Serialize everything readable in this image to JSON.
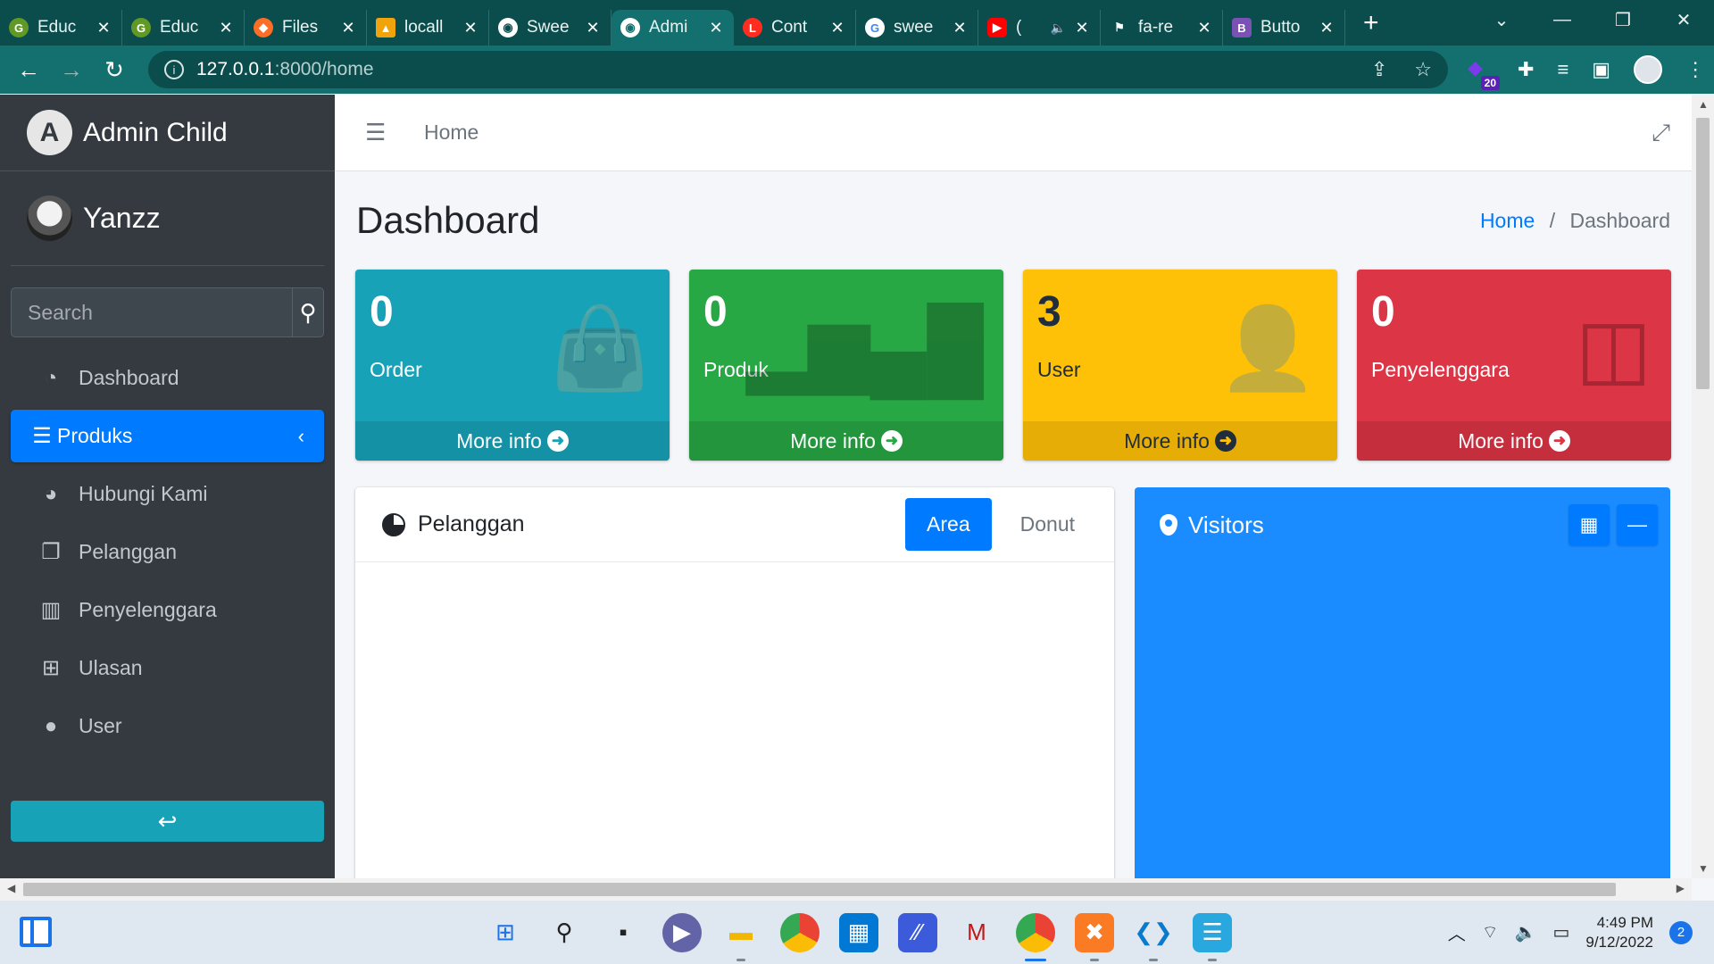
{
  "browser": {
    "tabs": [
      {
        "title": "Educ",
        "icon": "gitea-icon",
        "color": "#609926"
      },
      {
        "title": "Educ",
        "icon": "gitea-icon",
        "color": "#609926"
      },
      {
        "title": "Files",
        "icon": "gitlab-icon",
        "color": "#fc6d26"
      },
      {
        "title": "locall",
        "icon": "xampp-phpmyadmin-icon",
        "color": "#f0a30a"
      },
      {
        "title": "Swee",
        "icon": "globe-icon",
        "color": "#ffffff"
      },
      {
        "title": "Admi",
        "icon": "globe-icon",
        "color": "#ffffff",
        "active": true
      },
      {
        "title": "Cont",
        "icon": "laravel-icon",
        "color": "#ff2d20"
      },
      {
        "title": "swee",
        "icon": "google-icon",
        "color": "#4285f4"
      },
      {
        "title": "(",
        "icon": "youtube-icon",
        "color": "#ff0000"
      },
      {
        "title": "fa-re",
        "icon": "flag-icon",
        "color": "#ffffff"
      },
      {
        "title": "Butto",
        "icon": "bootstrap-icon",
        "color": "#7952b3"
      }
    ],
    "address": {
      "host": "127.0.0.1",
      "path": ":8000/home"
    },
    "extension_badge": "20"
  },
  "sidebar": {
    "brand": "Admin Child",
    "brand_logo_letter": "A",
    "user_name": "Yanzz",
    "search_placeholder": "Search",
    "items": [
      {
        "label": "Dashboard",
        "icon": "tachometer-icon"
      },
      {
        "label": "Produks",
        "icon": "list-icon",
        "active": true
      },
      {
        "label": "Hubungi Kami",
        "icon": "chart-pie-icon"
      },
      {
        "label": "Pelanggan",
        "icon": "copy-icon"
      },
      {
        "label": "Penyelenggara",
        "icon": "columns-icon"
      },
      {
        "label": "Ulasan",
        "icon": "plus-square-icon"
      },
      {
        "label": "User",
        "icon": "user-icon"
      }
    ],
    "back_icon": "reply-icon"
  },
  "topnav": {
    "home": "Home"
  },
  "header": {
    "title": "Dashboard",
    "breadcrumb": [
      {
        "label": "Home"
      },
      {
        "label": "Dashboard"
      }
    ]
  },
  "stats": [
    {
      "value": "0",
      "label": "Order",
      "footer": "More info",
      "color": "#17a2b8",
      "icon": "shopping-bag-icon"
    },
    {
      "value": "0",
      "label": "Produk",
      "footer": "More info",
      "color": "#28a745",
      "icon": "bar-chart-icon"
    },
    {
      "value": "3",
      "label": "User",
      "footer": "More info",
      "color": "#ffc107",
      "icon": "user-plus-icon"
    },
    {
      "value": "0",
      "label": "Penyelenggara",
      "footer": "More info",
      "color": "#dc3545",
      "icon": "columns-icon"
    }
  ],
  "pelanggan_card": {
    "title": "Pelanggan",
    "tabs": [
      "Area",
      "Donut"
    ],
    "active_tab": "Area"
  },
  "visitors_card": {
    "title": "Visitors",
    "color": "#1a8cff"
  },
  "taskbar": {
    "time": "4:49 PM",
    "date": "9/12/2022",
    "notifications": "2"
  }
}
